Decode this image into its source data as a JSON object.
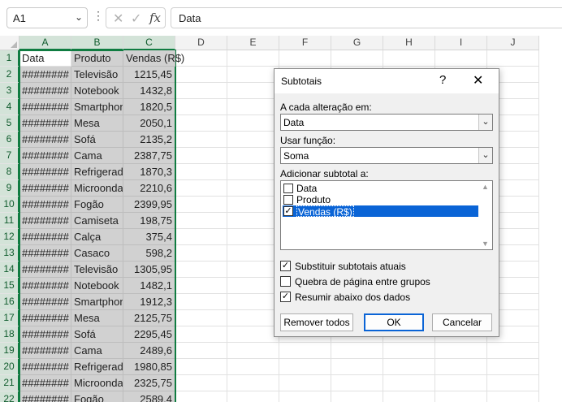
{
  "formula_bar": {
    "name_box": "A1",
    "more_icon": "⋮",
    "cancel_icon": "✕",
    "enter_icon": "✓",
    "fx_label": "fx",
    "formula": "Data"
  },
  "grid": {
    "columns": [
      "A",
      "B",
      "C",
      "D",
      "E",
      "F",
      "G",
      "H",
      "I",
      "J"
    ],
    "rows": [
      {
        "n": "1",
        "a": "Data",
        "b": "Produto",
        "c": "Vendas (R$)"
      },
      {
        "n": "2",
        "a": "########",
        "b": "Televisão",
        "c": "1215,45"
      },
      {
        "n": "3",
        "a": "########",
        "b": "Notebook",
        "c": "1432,8"
      },
      {
        "n": "4",
        "a": "########",
        "b": "Smartphone",
        "c": "1820,5"
      },
      {
        "n": "5",
        "a": "########",
        "b": "Mesa",
        "c": "2050,1"
      },
      {
        "n": "6",
        "a": "########",
        "b": "Sofá",
        "c": "2135,2"
      },
      {
        "n": "7",
        "a": "########",
        "b": "Cama",
        "c": "2387,75"
      },
      {
        "n": "8",
        "a": "########",
        "b": "Refrigerador",
        "c": "1870,3"
      },
      {
        "n": "9",
        "a": "########",
        "b": "Microondas",
        "c": "2210,6"
      },
      {
        "n": "10",
        "a": "########",
        "b": "Fogão",
        "c": "2399,95"
      },
      {
        "n": "11",
        "a": "########",
        "b": "Camiseta",
        "c": "198,75"
      },
      {
        "n": "12",
        "a": "########",
        "b": "Calça",
        "c": "375,4"
      },
      {
        "n": "13",
        "a": "########",
        "b": "Casaco",
        "c": "598,2"
      },
      {
        "n": "14",
        "a": "########",
        "b": "Televisão",
        "c": "1305,95"
      },
      {
        "n": "15",
        "a": "########",
        "b": "Notebook",
        "c": "1482,1"
      },
      {
        "n": "16",
        "a": "########",
        "b": "Smartphone",
        "c": "1912,3"
      },
      {
        "n": "17",
        "a": "########",
        "b": "Mesa",
        "c": "2125,75"
      },
      {
        "n": "18",
        "a": "########",
        "b": "Sofá",
        "c": "2295,45"
      },
      {
        "n": "19",
        "a": "########",
        "b": "Cama",
        "c": "2489,6"
      },
      {
        "n": "20",
        "a": "########",
        "b": "Refrigerador",
        "c": "1980,85"
      },
      {
        "n": "21",
        "a": "########",
        "b": "Microondas",
        "c": "2325,75"
      },
      {
        "n": "22",
        "a": "########",
        "b": "Fogão",
        "c": "2589,4"
      }
    ]
  },
  "dialog": {
    "title": "Subtotais",
    "help_icon": "?",
    "close_icon": "✕",
    "at_each_change_label": "A cada alteração em:",
    "at_each_change_value": "Data",
    "use_function_label": "Usar função:",
    "use_function_value": "Soma",
    "add_subtotal_label": "Adicionar subtotal a:",
    "columns": [
      {
        "label": "Data",
        "checked": false,
        "mark": ""
      },
      {
        "label": "Produto",
        "checked": false,
        "mark": ""
      },
      {
        "label": "Vendas (R$)",
        "checked": true,
        "mark": "✓"
      }
    ],
    "options": [
      {
        "label": "Substituir subtotais atuais",
        "checked": true,
        "mark": "✓"
      },
      {
        "label": "Quebra de página entre grupos",
        "checked": false,
        "mark": ""
      },
      {
        "label": "Resumir abaixo dos dados",
        "checked": true,
        "mark": "✓"
      }
    ],
    "remove_all_label": "Remover todos",
    "ok_label": "OK",
    "cancel_label": "Cancelar"
  },
  "colors": {
    "excel_green": "#107c41",
    "selection_blue": "#0a64d6",
    "selected_range_fill": "#d1d1d1"
  }
}
